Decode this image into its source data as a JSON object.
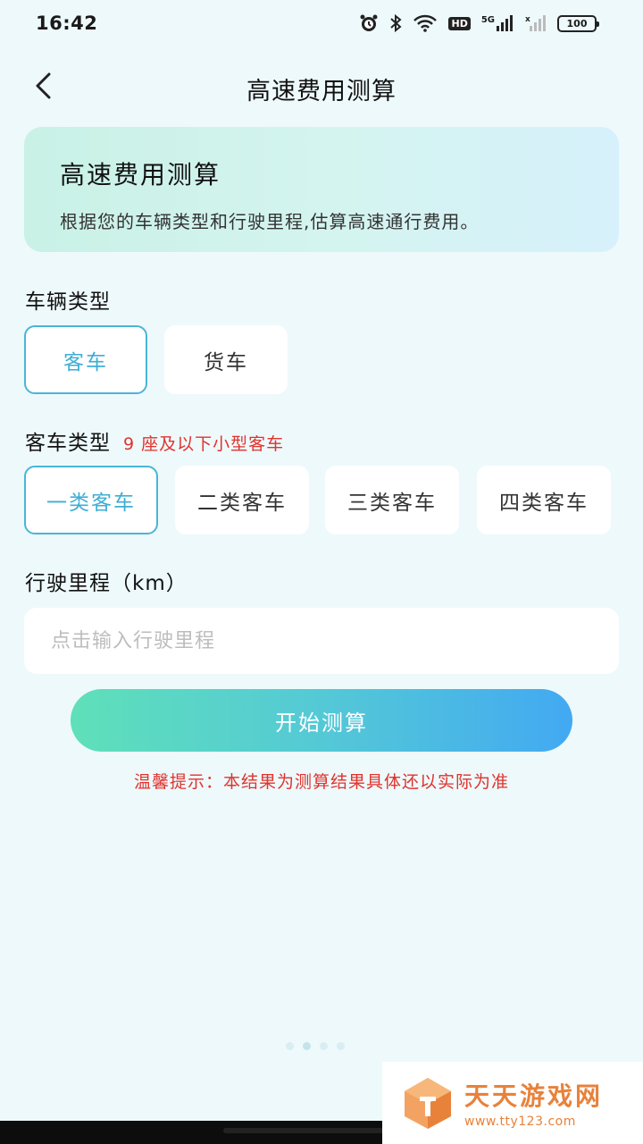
{
  "status_bar": {
    "time": "16:42",
    "network": "5G",
    "hd": "HD",
    "battery": "100"
  },
  "header": {
    "title": "高速费用测算"
  },
  "intro": {
    "title": "高速费用测算",
    "description": "根据您的车辆类型和行驶里程,估算高速通行费用。"
  },
  "vehicle_type": {
    "label": "车辆类型",
    "options": [
      "客车",
      "货车"
    ],
    "selected": "客车"
  },
  "bus_type": {
    "label": "客车类型",
    "hint": "9 座及以下小型客车",
    "options": [
      "一类客车",
      "二类客车",
      "三类客车",
      "四类客车"
    ],
    "selected": "一类客车"
  },
  "mileage": {
    "label": "行驶里程（km）",
    "placeholder": "点击输入行驶里程",
    "value": ""
  },
  "actions": {
    "start_label": "开始测算"
  },
  "tip": "温馨提示：本结果为测算结果具体还以实际为准",
  "watermark": {
    "name": "天天游戏网",
    "url": "www.tty123.com"
  },
  "colors": {
    "accent": "#3eaed4",
    "warning": "#e0332e",
    "watermark": "#e8823b"
  }
}
